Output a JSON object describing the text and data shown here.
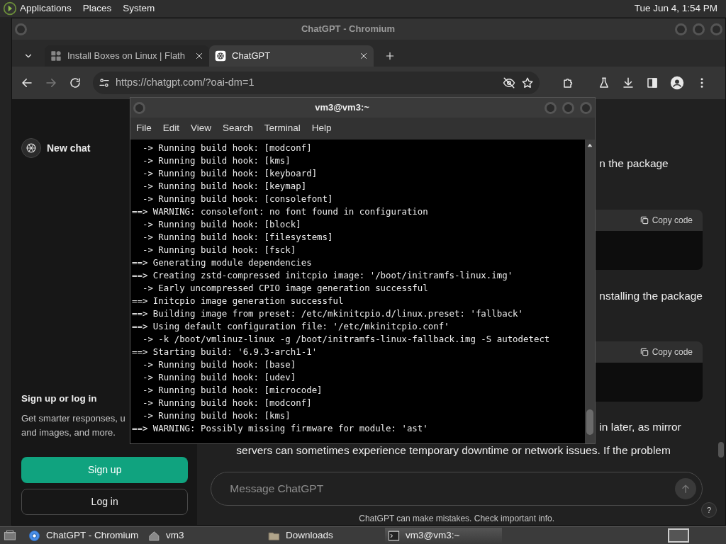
{
  "desktop_panel": {
    "menus": [
      "Applications",
      "Places",
      "System"
    ],
    "clock": "Tue Jun 4, 1:54 PM"
  },
  "browser": {
    "title": "ChatGPT - Chromium",
    "tabs": [
      {
        "label": "Install Boxes on Linux | Flath",
        "selected": false
      },
      {
        "label": "ChatGPT",
        "selected": true
      }
    ],
    "forward_disabled": true,
    "address": "https://chatgpt.com/?oai-dm=1",
    "sidebar": {
      "new_chat": "New chat",
      "signup_title": "Sign up or log in",
      "signup_text": [
        "Get smarter responses, u",
        "and images, and more."
      ],
      "buttons": [
        {
          "label": "Sign up",
          "kind": "primary"
        },
        {
          "label": "Log in",
          "kind": "outline"
        }
      ]
    },
    "conversation": {
      "items": [
        {
          "kind": "text",
          "text": "n the package"
        },
        {
          "kind": "code",
          "copy": "Copy code"
        },
        {
          "kind": "text",
          "text": "nstalling the package"
        },
        {
          "kind": "code",
          "copy": "Copy code"
        },
        {
          "kind": "text",
          "text": "in later, as mirror"
        },
        {
          "kind": "text",
          "text": "servers can sometimes experience temporary downtime or network issues. If the problem"
        }
      ],
      "composer": {
        "placeholder": "Message ChatGPT"
      },
      "disclaimer": "ChatGPT can make mistakes. Check important info.",
      "help": "?"
    }
  },
  "terminal": {
    "title": "vm3@vm3:~",
    "menu": [
      "File",
      "Edit",
      "View",
      "Search",
      "Terminal",
      "Help"
    ],
    "lines": [
      "  -> Running build hook: [modconf]",
      "  -> Running build hook: [kms]",
      "  -> Running build hook: [keyboard]",
      "  -> Running build hook: [keymap]",
      "  -> Running build hook: [consolefont]",
      "==> WARNING: consolefont: no font found in configuration",
      "  -> Running build hook: [block]",
      "  -> Running build hook: [filesystems]",
      "  -> Running build hook: [fsck]",
      "==> Generating module dependencies",
      "==> Creating zstd-compressed initcpio image: '/boot/initramfs-linux.img'",
      "  -> Early uncompressed CPIO image generation successful",
      "==> Initcpio image generation successful",
      "==> Building image from preset: /etc/mkinitcpio.d/linux.preset: 'fallback'",
      "==> Using default configuration file: '/etc/mkinitcpio.conf'",
      "  -> -k /boot/vmlinuz-linux -g /boot/initramfs-linux-fallback.img -S autodetect",
      "==> Starting build: '6.9.3-arch1-1'",
      "  -> Running build hook: [base]",
      "  -> Running build hook: [udev]",
      "  -> Running build hook: [microcode]",
      "  -> Running build hook: [modconf]",
      "  -> Running build hook: [kms]",
      "==> WARNING: Possibly missing firmware for module: 'ast'"
    ]
  },
  "taskbar": {
    "items": [
      {
        "label": "ChatGPT - Chromium",
        "kind": "browser",
        "selected": false
      },
      {
        "label": "vm3",
        "kind": "home",
        "selected": false
      },
      {
        "label": "Downloads",
        "kind": "folder",
        "selected": false
      },
      {
        "label": "vm3@vm3:~",
        "kind": "terminal",
        "selected": true
      }
    ]
  }
}
